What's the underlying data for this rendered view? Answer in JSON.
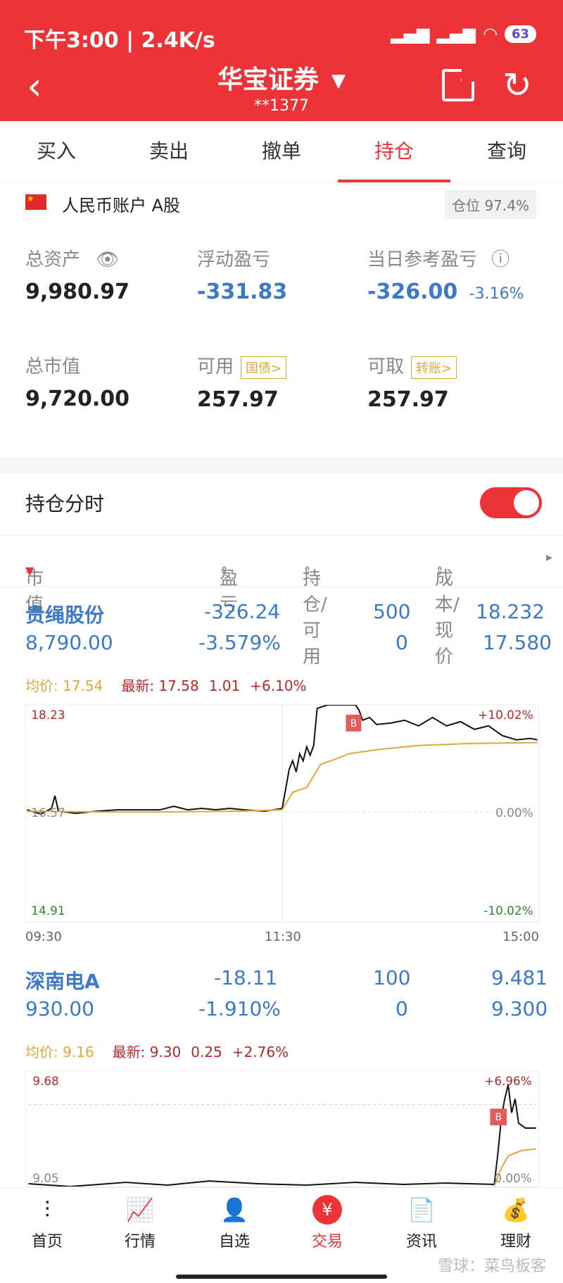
{
  "status": {
    "time": "下午3:00 | 2.4K/s",
    "battery": "63"
  },
  "nav": {
    "title": "华宝证券",
    "account_masked": "**1377"
  },
  "tabs": [
    "买入",
    "卖出",
    "撤单",
    "持仓",
    "查询"
  ],
  "account": {
    "label": "人民币账户 A股",
    "position_pct": "仓位 97.4%"
  },
  "summary": {
    "total_assets_label": "总资产",
    "total_assets": "9,980.97",
    "float_pl_label": "浮动盈亏",
    "float_pl": "-331.83",
    "daily_pl_label": "当日参考盈亏",
    "daily_pl": "-326.00",
    "daily_pl_pct": "-3.16%",
    "market_value_label": "总市值",
    "market_value": "9,720.00",
    "available_label": "可用",
    "available_chip": "国债>",
    "available": "257.97",
    "withdraw_label": "可取",
    "withdraw_chip": "转账>",
    "withdraw": "257.97"
  },
  "section": {
    "title": "持仓分时"
  },
  "columns": {
    "c1": "市值",
    "c2": "盈亏",
    "c3": "持仓/可用",
    "c4": "成本/现价"
  },
  "holdings": [
    {
      "name": "贵绳股份",
      "pl": "-326.24",
      "qty": "500",
      "cost": "18.232",
      "mv": "8,790.00",
      "pl_pct": "-3.579%",
      "avail": "0",
      "price": "17.580",
      "avg": "均价: 17.54",
      "latest": "最新: 17.58",
      "change": "1.01",
      "change_pct": "+6.10%",
      "hi": "18.23",
      "lo": "14.91",
      "mid": "16.57",
      "hi_pct": "+10.02%",
      "lo_pct": "-10.02%",
      "zero": "0.00%"
    },
    {
      "name": "深南电A",
      "pl": "-18.11",
      "qty": "100",
      "cost": "9.481",
      "mv": "930.00",
      "pl_pct": "-1.910%",
      "avail": "0",
      "price": "9.300",
      "avg": "均价: 9.16",
      "latest": "最新: 9.30",
      "change": "0.25",
      "change_pct": "+2.76%",
      "hi": "9.68",
      "mid": "9.05",
      "hi_pct": "+6.96%",
      "zero": "0.00%"
    }
  ],
  "time_axis": [
    "09:30",
    "11:30",
    "15:00"
  ],
  "bottom_nav": [
    "首页",
    "行情",
    "自选",
    "交易",
    "资讯",
    "理财"
  ],
  "watermark": "雪球：菜鸟板客",
  "colors": {
    "brand": "#ec3338",
    "blue": "#3d79c7",
    "avg_line": "#e0a83a",
    "up": "#b8282d",
    "down": "#2a8a3a"
  }
}
